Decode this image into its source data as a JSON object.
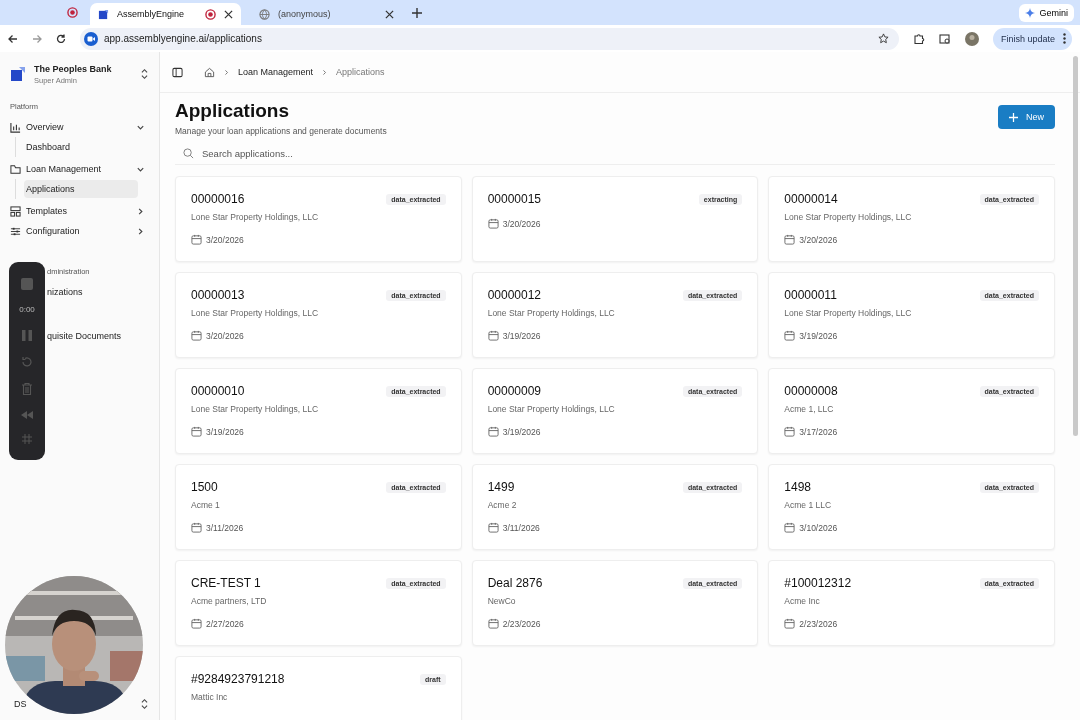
{
  "browser": {
    "tabs": [
      {
        "title": "AssemblyEngine",
        "selected": true,
        "recording": true
      },
      {
        "title": "(anonymous)",
        "selected": false,
        "recording": false
      }
    ],
    "gemini": "Gemini",
    "url": "app.assemblyengine.ai/applications",
    "update_button": "Finish update"
  },
  "sidebar": {
    "org": "The Peoples Bank",
    "role": "Super Admin",
    "section": "Platform",
    "items": [
      {
        "label": "Overview",
        "expanded": true,
        "children": [
          {
            "label": "Dashboard",
            "selected": false
          }
        ]
      },
      {
        "label": "Loan Management",
        "expanded": true,
        "children": [
          {
            "label": "Applications",
            "selected": true
          }
        ]
      },
      {
        "label": "Templates",
        "expanded": false
      },
      {
        "label": "Configuration",
        "expanded": false
      }
    ],
    "section_2": "dministration",
    "items_2": [
      "nizations",
      "quisite Documents"
    ],
    "user_initials": "DS"
  },
  "breadcrumb": [
    "Loan Management",
    "Applications"
  ],
  "page": {
    "title": "Applications",
    "subtitle": "Manage your loan applications and generate documents",
    "new_button": "New",
    "search": {
      "placeholder": "Search applications..."
    }
  },
  "cards": [
    {
      "name": "00000016",
      "company": "Lone Star Property Holdings, LLC",
      "date": "3/20/2026",
      "status": "data_extracted"
    },
    {
      "name": "00000015",
      "date": "3/20/2026",
      "status": "extracting"
    },
    {
      "name": "00000014",
      "company": "Lone Star Property Holdings, LLC",
      "date": "3/20/2026",
      "status": "data_extracted"
    },
    {
      "name": "00000013",
      "company": "Lone Star Property Holdings, LLC",
      "date": "3/20/2026",
      "status": "data_extracted"
    },
    {
      "name": "00000012",
      "company": "Lone Star Property Holdings, LLC",
      "date": "3/19/2026",
      "status": "data_extracted"
    },
    {
      "name": "00000011",
      "company": "Lone Star Property Holdings, LLC",
      "date": "3/19/2026",
      "status": "data_extracted"
    },
    {
      "name": "00000010",
      "company": "Lone Star Property Holdings, LLC",
      "date": "3/19/2026",
      "status": "data_extracted"
    },
    {
      "name": "00000009",
      "company": "Lone Star Property Holdings, LLC",
      "date": "3/19/2026",
      "status": "data_extracted"
    },
    {
      "name": "00000008",
      "company": "Acme 1, LLC",
      "date": "3/17/2026",
      "status": "data_extracted"
    },
    {
      "name": "1500",
      "company": "Acme 1",
      "date": "3/11/2026",
      "status": "data_extracted"
    },
    {
      "name": "1499",
      "company": "Acme 2",
      "date": "3/11/2026",
      "status": "data_extracted"
    },
    {
      "name": "1498",
      "company": "Acme 1 LLC",
      "date": "3/10/2026",
      "status": "data_extracted"
    },
    {
      "name": "CRE-TEST 1",
      "company": "Acme partners, LTD",
      "date": "2/27/2026",
      "status": "data_extracted"
    },
    {
      "name": "Deal 2876",
      "company": "NewCo",
      "date": "2/23/2026",
      "status": "data_extracted"
    },
    {
      "name": "#100012312",
      "company": "Acme Inc",
      "date": "2/23/2026",
      "status": "data_extracted"
    },
    {
      "name": "#9284923791218",
      "company": "Mattic Inc",
      "status": "draft"
    }
  ],
  "recorder": {
    "time": "0:00"
  }
}
